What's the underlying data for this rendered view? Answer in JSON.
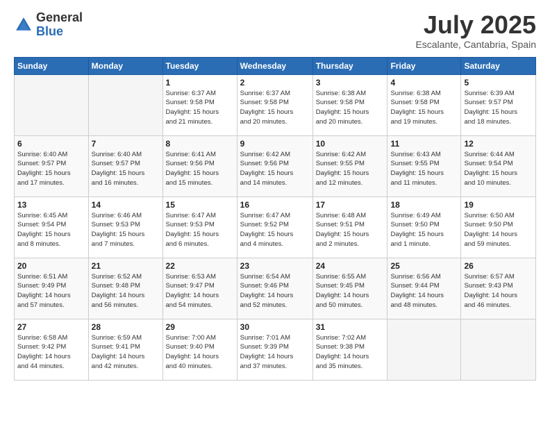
{
  "header": {
    "logo_general": "General",
    "logo_blue": "Blue",
    "month": "July 2025",
    "location": "Escalante, Cantabria, Spain"
  },
  "weekdays": [
    "Sunday",
    "Monday",
    "Tuesday",
    "Wednesday",
    "Thursday",
    "Friday",
    "Saturday"
  ],
  "weeks": [
    [
      {
        "day": "",
        "info": ""
      },
      {
        "day": "",
        "info": ""
      },
      {
        "day": "1",
        "info": "Sunrise: 6:37 AM\nSunset: 9:58 PM\nDaylight: 15 hours\nand 21 minutes."
      },
      {
        "day": "2",
        "info": "Sunrise: 6:37 AM\nSunset: 9:58 PM\nDaylight: 15 hours\nand 20 minutes."
      },
      {
        "day": "3",
        "info": "Sunrise: 6:38 AM\nSunset: 9:58 PM\nDaylight: 15 hours\nand 20 minutes."
      },
      {
        "day": "4",
        "info": "Sunrise: 6:38 AM\nSunset: 9:58 PM\nDaylight: 15 hours\nand 19 minutes."
      },
      {
        "day": "5",
        "info": "Sunrise: 6:39 AM\nSunset: 9:57 PM\nDaylight: 15 hours\nand 18 minutes."
      }
    ],
    [
      {
        "day": "6",
        "info": "Sunrise: 6:40 AM\nSunset: 9:57 PM\nDaylight: 15 hours\nand 17 minutes."
      },
      {
        "day": "7",
        "info": "Sunrise: 6:40 AM\nSunset: 9:57 PM\nDaylight: 15 hours\nand 16 minutes."
      },
      {
        "day": "8",
        "info": "Sunrise: 6:41 AM\nSunset: 9:56 PM\nDaylight: 15 hours\nand 15 minutes."
      },
      {
        "day": "9",
        "info": "Sunrise: 6:42 AM\nSunset: 9:56 PM\nDaylight: 15 hours\nand 14 minutes."
      },
      {
        "day": "10",
        "info": "Sunrise: 6:42 AM\nSunset: 9:55 PM\nDaylight: 15 hours\nand 12 minutes."
      },
      {
        "day": "11",
        "info": "Sunrise: 6:43 AM\nSunset: 9:55 PM\nDaylight: 15 hours\nand 11 minutes."
      },
      {
        "day": "12",
        "info": "Sunrise: 6:44 AM\nSunset: 9:54 PM\nDaylight: 15 hours\nand 10 minutes."
      }
    ],
    [
      {
        "day": "13",
        "info": "Sunrise: 6:45 AM\nSunset: 9:54 PM\nDaylight: 15 hours\nand 8 minutes."
      },
      {
        "day": "14",
        "info": "Sunrise: 6:46 AM\nSunset: 9:53 PM\nDaylight: 15 hours\nand 7 minutes."
      },
      {
        "day": "15",
        "info": "Sunrise: 6:47 AM\nSunset: 9:53 PM\nDaylight: 15 hours\nand 6 minutes."
      },
      {
        "day": "16",
        "info": "Sunrise: 6:47 AM\nSunset: 9:52 PM\nDaylight: 15 hours\nand 4 minutes."
      },
      {
        "day": "17",
        "info": "Sunrise: 6:48 AM\nSunset: 9:51 PM\nDaylight: 15 hours\nand 2 minutes."
      },
      {
        "day": "18",
        "info": "Sunrise: 6:49 AM\nSunset: 9:50 PM\nDaylight: 15 hours\nand 1 minute."
      },
      {
        "day": "19",
        "info": "Sunrise: 6:50 AM\nSunset: 9:50 PM\nDaylight: 14 hours\nand 59 minutes."
      }
    ],
    [
      {
        "day": "20",
        "info": "Sunrise: 6:51 AM\nSunset: 9:49 PM\nDaylight: 14 hours\nand 57 minutes."
      },
      {
        "day": "21",
        "info": "Sunrise: 6:52 AM\nSunset: 9:48 PM\nDaylight: 14 hours\nand 56 minutes."
      },
      {
        "day": "22",
        "info": "Sunrise: 6:53 AM\nSunset: 9:47 PM\nDaylight: 14 hours\nand 54 minutes."
      },
      {
        "day": "23",
        "info": "Sunrise: 6:54 AM\nSunset: 9:46 PM\nDaylight: 14 hours\nand 52 minutes."
      },
      {
        "day": "24",
        "info": "Sunrise: 6:55 AM\nSunset: 9:45 PM\nDaylight: 14 hours\nand 50 minutes."
      },
      {
        "day": "25",
        "info": "Sunrise: 6:56 AM\nSunset: 9:44 PM\nDaylight: 14 hours\nand 48 minutes."
      },
      {
        "day": "26",
        "info": "Sunrise: 6:57 AM\nSunset: 9:43 PM\nDaylight: 14 hours\nand 46 minutes."
      }
    ],
    [
      {
        "day": "27",
        "info": "Sunrise: 6:58 AM\nSunset: 9:42 PM\nDaylight: 14 hours\nand 44 minutes."
      },
      {
        "day": "28",
        "info": "Sunrise: 6:59 AM\nSunset: 9:41 PM\nDaylight: 14 hours\nand 42 minutes."
      },
      {
        "day": "29",
        "info": "Sunrise: 7:00 AM\nSunset: 9:40 PM\nDaylight: 14 hours\nand 40 minutes."
      },
      {
        "day": "30",
        "info": "Sunrise: 7:01 AM\nSunset: 9:39 PM\nDaylight: 14 hours\nand 37 minutes."
      },
      {
        "day": "31",
        "info": "Sunrise: 7:02 AM\nSunset: 9:38 PM\nDaylight: 14 hours\nand 35 minutes."
      },
      {
        "day": "",
        "info": ""
      },
      {
        "day": "",
        "info": ""
      }
    ]
  ]
}
